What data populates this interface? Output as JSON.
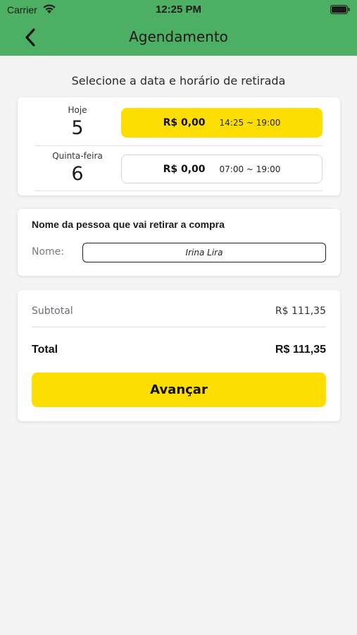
{
  "status_bar": {
    "carrier": "Carrier",
    "time": "12:25 PM"
  },
  "header": {
    "title": "Agendamento",
    "back_icon": "chevron-left-icon",
    "background_color": "#4caf64"
  },
  "schedule": {
    "heading": "Selecione a data e horário de retirada",
    "days": [
      {
        "label": "Hoje",
        "day_number": "5",
        "price": "R$ 0,00",
        "time_range": "14:25 ~ 19:00",
        "selected": true
      },
      {
        "label": "Quinta-feira",
        "day_number": "6",
        "price": "R$ 0,00",
        "time_range": "07:00 ~ 19:00",
        "selected": false
      }
    ],
    "selected_color": "#fede00"
  },
  "pickup_person": {
    "heading": "Nome da pessoa que vai retirar a compra",
    "name_label": "Nome:",
    "name_value": "Irina Lira"
  },
  "summary": {
    "subtotal_label": "Subtotal",
    "subtotal_value": "R$ 111,35",
    "total_label": "Total",
    "total_value": "R$ 111,35",
    "next_button_label": "Avançar"
  }
}
